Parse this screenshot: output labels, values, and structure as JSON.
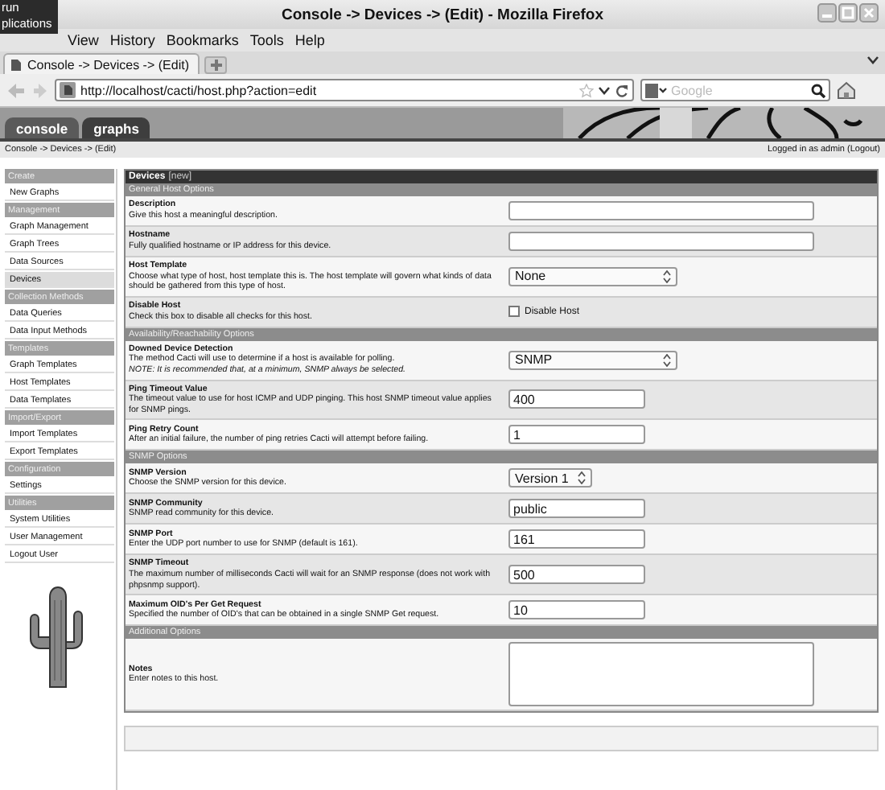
{
  "overlay": {
    "lines": [
      "run",
      "plications"
    ]
  },
  "window": {
    "title": "Console -> Devices -> (Edit) - Mozilla Firefox"
  },
  "menu": [
    "View",
    "History",
    "Bookmarks",
    "Tools",
    "Help"
  ],
  "browser_tab": {
    "label": "Console -> Devices -> (Edit)"
  },
  "address": {
    "value": "http://localhost/cacti/host.php?action=edit"
  },
  "search": {
    "placeholder": "Google"
  },
  "app_tabs": [
    {
      "label": "console",
      "selected": true
    },
    {
      "label": "graphs",
      "selected": false
    }
  ],
  "breadcrumb": "Console -> Devices -> (Edit)",
  "login": "Logged in as admin (Logout)",
  "sidebar": [
    {
      "kind": "header",
      "label": "Create"
    },
    {
      "kind": "item",
      "label": "New Graphs",
      "selected": false
    },
    {
      "kind": "header",
      "label": "Management"
    },
    {
      "kind": "item",
      "label": "Graph Management",
      "selected": false
    },
    {
      "kind": "item",
      "label": "Graph Trees",
      "selected": false
    },
    {
      "kind": "item",
      "label": "Data Sources",
      "selected": false
    },
    {
      "kind": "item",
      "label": "Devices",
      "selected": true
    },
    {
      "kind": "header",
      "label": "Collection Methods"
    },
    {
      "kind": "item",
      "label": "Data Queries",
      "selected": false
    },
    {
      "kind": "item",
      "label": "Data Input Methods",
      "selected": false
    },
    {
      "kind": "header",
      "label": "Templates"
    },
    {
      "kind": "item",
      "label": "Graph Templates",
      "selected": false
    },
    {
      "kind": "item",
      "label": "Host Templates",
      "selected": false
    },
    {
      "kind": "item",
      "label": "Data Templates",
      "selected": false
    },
    {
      "kind": "header",
      "label": "Import/Export"
    },
    {
      "kind": "item",
      "label": "Import Templates",
      "selected": false
    },
    {
      "kind": "item",
      "label": "Export Templates",
      "selected": false
    },
    {
      "kind": "header",
      "label": "Configuration"
    },
    {
      "kind": "item",
      "label": "Settings",
      "selected": false
    },
    {
      "kind": "header",
      "label": "Utilities"
    },
    {
      "kind": "item",
      "label": "System Utilities",
      "selected": false
    },
    {
      "kind": "item",
      "label": "User Management",
      "selected": false
    },
    {
      "kind": "item",
      "label": "Logout User",
      "selected": false
    }
  ],
  "form": {
    "title": "Devices",
    "title_note": "[new]",
    "rows": [
      {
        "kind": "section",
        "label": "General Host Options"
      },
      {
        "kind": "text",
        "label": "Description",
        "help": "Give this host a meaningful description."
      },
      {
        "kind": "text",
        "label": "Hostname",
        "help": "Fully qualified hostname or IP address for this device."
      },
      {
        "kind": "select",
        "label": "Host Template",
        "help": "Choose what type of host, host template this is. The host template will govern what kinds of data should be gathered from this type of host.",
        "value": "None"
      },
      {
        "kind": "checkbox",
        "label": "Disable Host",
        "help": "Check this box to disable all checks for this host.",
        "caption": "Disable Host",
        "checked": false
      },
      {
        "kind": "section",
        "label": "Availability/Reachability Options"
      },
      {
        "kind": "select",
        "label": "Downed Device Detection",
        "help": "The method Cacti will use to determine if a host is available for polling.",
        "note": "NOTE: It is recommended that, at a minimum, SNMP always be selected.",
        "value": "SNMP"
      },
      {
        "kind": "text",
        "label": "Ping Timeout Value",
        "help": "The timeout value to use for host ICMP and UDP pinging. This host SNMP timeout value applies for SNMP pings.",
        "value": "400"
      },
      {
        "kind": "text",
        "label": "Ping Retry Count",
        "help": "After an initial failure, the number of ping retries Cacti will attempt before failing.",
        "value": "1"
      },
      {
        "kind": "section",
        "label": "SNMP Options"
      },
      {
        "kind": "select",
        "label": "SNMP Version",
        "help": "Choose the SNMP version for this device.",
        "value": "Version 1"
      },
      {
        "kind": "text",
        "label": "SNMP Community",
        "help": "SNMP read community for this device.",
        "value": "public"
      },
      {
        "kind": "text",
        "label": "SNMP Port",
        "help": "Enter the UDP port number to use for SNMP (default is 161).",
        "value": "161"
      },
      {
        "kind": "text",
        "label": "SNMP Timeout",
        "help": "The maximum number of milliseconds Cacti will wait for an SNMP response (does not work with phpsnmp support).",
        "value": "500"
      },
      {
        "kind": "text",
        "label": "Maximum OID's Per Get Request",
        "help": "Specified the number of OID's that can be obtained in a single SNMP Get request.",
        "value": "10"
      },
      {
        "kind": "section",
        "label": "Additional Options"
      },
      {
        "kind": "textarea",
        "label": "Notes",
        "help": "Enter notes to this host."
      }
    ]
  }
}
